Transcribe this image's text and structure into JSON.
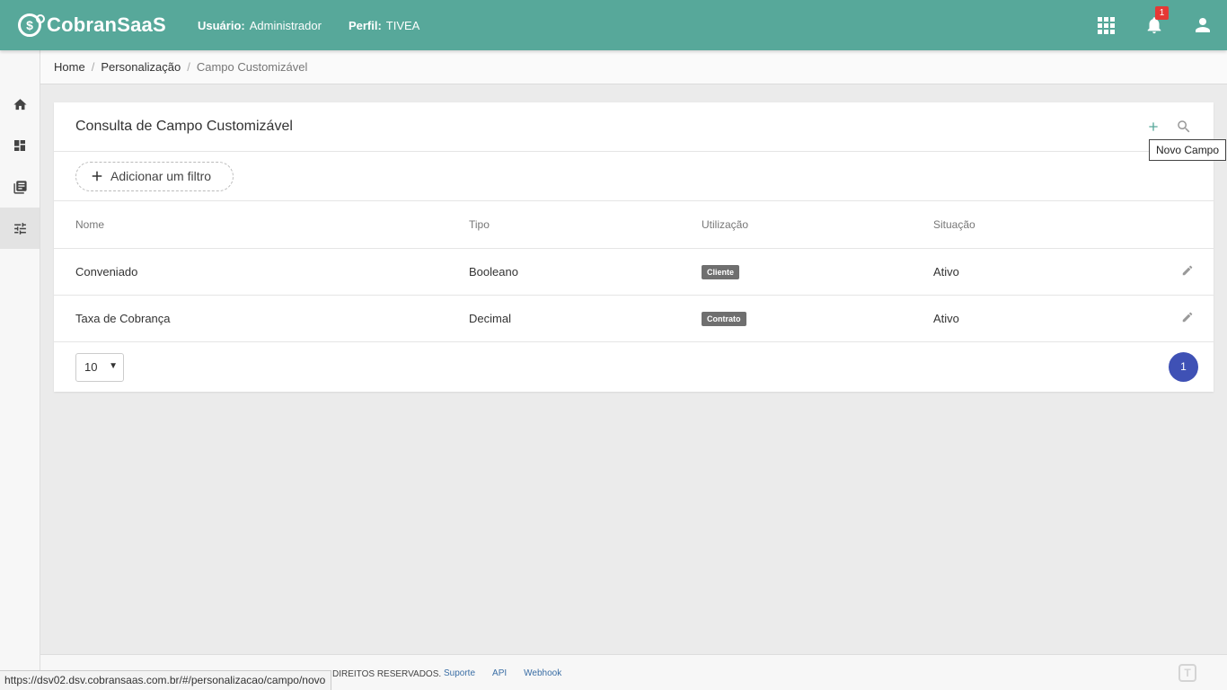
{
  "header": {
    "logo_text": "CobranSaaS",
    "user_label": "Usuário:",
    "user_value": "Administrador",
    "profile_label": "Perfil:",
    "profile_value": "TIVEA",
    "notification_count": "1"
  },
  "sidebar": {
    "items": [
      {
        "icon": "home-icon"
      },
      {
        "icon": "dashboard-icon"
      },
      {
        "icon": "library-icon"
      },
      {
        "icon": "tune-icon"
      }
    ]
  },
  "breadcrumb": {
    "items": [
      "Home",
      "Personalização"
    ],
    "current": "Campo Customizável"
  },
  "card": {
    "title": "Consulta de Campo Customizável",
    "tooltip": "Novo Campo",
    "filter_label": "Adicionar um filtro",
    "columns": [
      "Nome",
      "Tipo",
      "Utilização",
      "Situação"
    ],
    "rows": [
      {
        "nome": "Conveniado",
        "tipo": "Booleano",
        "utilizacao": "Cliente",
        "situacao": "Ativo"
      },
      {
        "nome": "Taxa de Cobrança",
        "tipo": "Decimal",
        "utilizacao": "Contrato",
        "situacao": "Ativo"
      }
    ],
    "page_size": "10",
    "current_page": "1"
  },
  "footer": {
    "rights_text": "DIREITOS RESERVADOS.",
    "links": [
      "Suporte",
      "API",
      "Webhook"
    ]
  },
  "statusbar": {
    "url": "https://dsv02.dsv.cobransaas.com.br/#/personalizacao/campo/novo"
  },
  "colors": {
    "topbar": "#57a89a",
    "badge": "#6f6f6f",
    "pagination": "#3f51b5",
    "notification": "#e53935"
  }
}
